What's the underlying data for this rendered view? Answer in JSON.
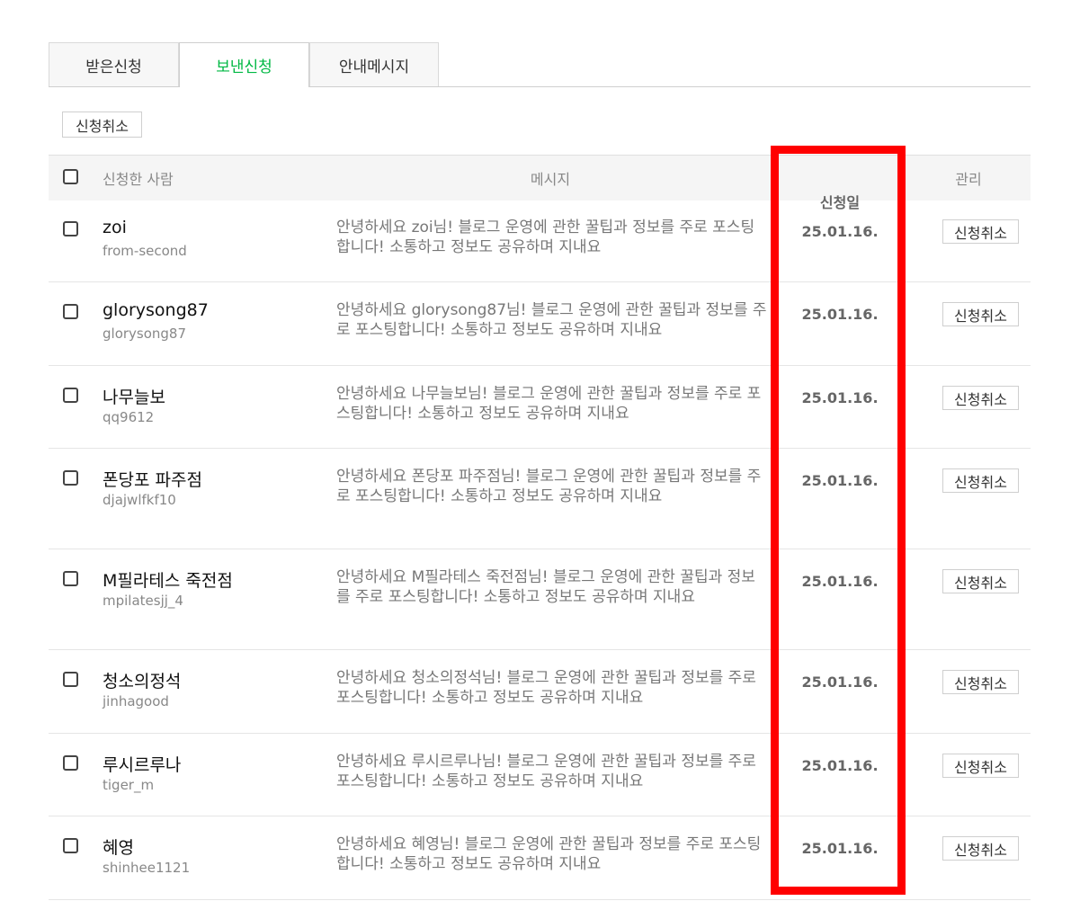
{
  "tabs": [
    {
      "label": "받은신청",
      "active": false
    },
    {
      "label": "보낸신청",
      "active": true
    },
    {
      "label": "안내메시지",
      "active": false
    }
  ],
  "toolbar": {
    "cancel_label": "신청취소"
  },
  "table": {
    "headers": {
      "applicant": "신청한 사람",
      "message": "메시지",
      "date": "신청일",
      "manage": "관리"
    },
    "rows": [
      {
        "name": "zoi",
        "id": "from-second",
        "message": "안녕하세요 zoi님! 블로그 운영에 관한 꿀팁과 정보를 주로 포스팅합니다! 소통하고 정보도 공유하며 지내요",
        "date": "25.01.16.",
        "action": "신청취소"
      },
      {
        "name": "glorysong87",
        "id": "glorysong87",
        "message": "안녕하세요 glorysong87님! 블로그 운영에 관한 꿀팁과 정보를 주로 포스팅합니다! 소통하고 정보도 공유하며 지내요",
        "date": "25.01.16.",
        "action": "신청취소"
      },
      {
        "name": "나무늘보",
        "id": "qq9612",
        "message": "안녕하세요 나무늘보님! 블로그 운영에 관한 꿀팁과 정보를 주로 포스팅합니다! 소통하고 정보도 공유하며 지내요",
        "date": "25.01.16.",
        "action": "신청취소"
      },
      {
        "name": "폰당포 파주점",
        "id": "djajwlfkf10",
        "message": "안녕하세요 폰당포 파주점님! 블로그 운영에 관한 꿀팁과 정보를 주로 포스팅합니다! 소통하고 정보도 공유하며 지내요",
        "date": "25.01.16.",
        "action": "신청취소"
      },
      {
        "name": "M필라테스 죽전점",
        "id": "mpilatesjj_4",
        "message": "안녕하세요 M필라테스 죽전점님! 블로그 운영에 관한 꿀팁과 정보를 주로 포스팅합니다! 소통하고 정보도 공유하며 지내요",
        "date": "25.01.16.",
        "action": "신청취소"
      },
      {
        "name": "청소의정석",
        "id": "jinhagood",
        "message": "안녕하세요 청소의정석님! 블로그 운영에 관한 꿀팁과 정보를 주로 포스팅합니다! 소통하고 정보도 공유하며 지내요",
        "date": "25.01.16.",
        "action": "신청취소"
      },
      {
        "name": "루시르루나",
        "id": "tiger_m",
        "message": "안녕하세요 루시르루나님! 블로그 운영에 관한 꿀팁과 정보를 주로 포스팅합니다! 소통하고 정보도 공유하며 지내요",
        "date": "25.01.16.",
        "action": "신청취소"
      },
      {
        "name": "혜영",
        "id": "shinhee1121",
        "message": "안녕하세요 혜영님! 블로그 운영에 관한 꿀팁과 정보를 주로 포스팅합니다! 소통하고 정보도 공유하며 지내요",
        "date": "25.01.16.",
        "action": "신청취소"
      }
    ]
  },
  "colors": {
    "active_tab": "#00b843",
    "highlight": "#ff0000"
  }
}
